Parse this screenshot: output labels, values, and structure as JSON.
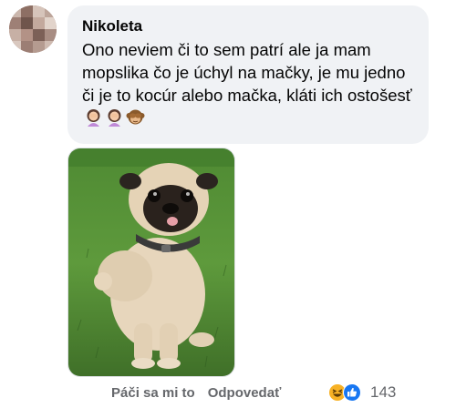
{
  "comment": {
    "author": "Nikoleta",
    "lines": [
      "Ono neviem či to sem patrí ale ja mam",
      "mopslika čo je úchyl na mačky, je mu",
      "jedno či je to kocúr alebo mačka, kláti ich",
      "ostošesť"
    ],
    "emojis": [
      "woman-facepalming-emoji",
      "woman-facepalming-emoji",
      "see-no-evil-monkey-emoji"
    ],
    "photo_alt_icon": "pug-photo"
  },
  "actions": {
    "like_label": "Páči sa mi to",
    "reply_label": "Odpovedať"
  },
  "reactions": {
    "icons": [
      "haha-reaction-icon",
      "like-reaction-icon"
    ],
    "count": "143",
    "colors": {
      "like": "#1877f2",
      "haha": "#f7b125"
    }
  }
}
